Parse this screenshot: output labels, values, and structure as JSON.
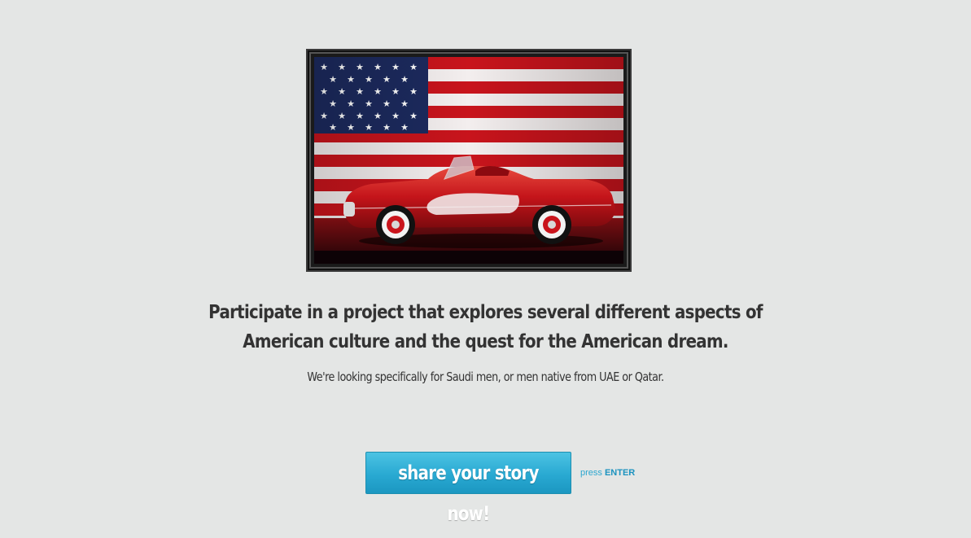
{
  "hero": {
    "image_name": "american-flag-red-convertible"
  },
  "content": {
    "headline": "Participate in a project that explores several different aspects of American culture and the quest for the American dream.",
    "subline": "We're looking specifically for Saudi men, or men native from UAE or Qatar."
  },
  "cta": {
    "button_label": "share your story now!",
    "hint_prefix": "press",
    "hint_key": "ENTER"
  },
  "colors": {
    "background": "#e4e6e5",
    "text": "#333333",
    "button": "#29a9d2",
    "hint": "#2aa6cf"
  }
}
